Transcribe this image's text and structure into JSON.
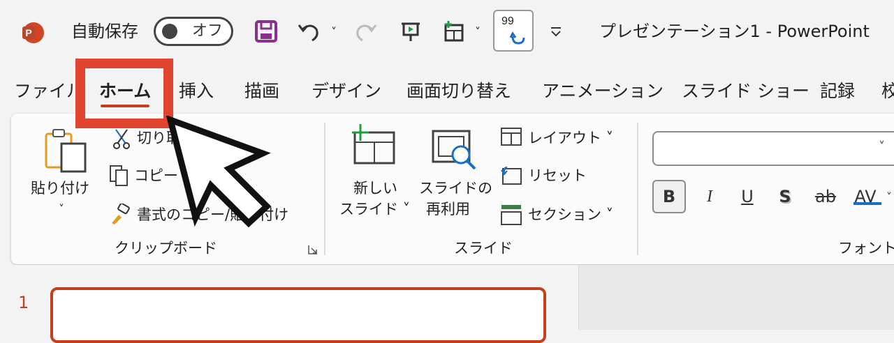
{
  "titlebar": {
    "autosave_label": "自動保存",
    "autosave_state": "オフ",
    "document_title": "プレゼンテーション1  -  PowerPoint",
    "icons": [
      "powerpoint-logo-icon",
      "save-icon",
      "undo-icon",
      "redo-icon",
      "present-icon",
      "layout-icon",
      "zoom-icon",
      "customize-qat-icon"
    ],
    "zoom_icon_text": "99"
  },
  "tabs": [
    "ファイル",
    "ホーム",
    "挿入",
    "描画",
    "デザイン",
    "画面切り替え",
    "アニメーション",
    "スライド ショー",
    "記録",
    "校"
  ],
  "active_tab": "ホーム",
  "ribbon": {
    "clipboard": {
      "paste_label_line1": "貼り付け",
      "paste_label_line2": "˅",
      "cut_label": "切り取",
      "copy_label": "コピー",
      "format_painter_label": "書式のコピー/貼り付け",
      "group_label": "クリップボード"
    },
    "slides": {
      "new_slide_line1": "新しい",
      "new_slide_line2": "スライド ˅",
      "reuse_line1": "スライドの",
      "reuse_line2": "再利用",
      "layout_label": "レイアウト ˅",
      "reset_label": "リセット",
      "section_label": "セクション ˅",
      "group_label": "スライド"
    },
    "font": {
      "font_name_value": "",
      "bold": "B",
      "italic": "I",
      "underline": "U",
      "shadow": "S",
      "strikethrough": "ab",
      "spacing": "AV",
      "group_label": "フォント"
    }
  },
  "thumbnails": {
    "slide_number": "1"
  },
  "colors": {
    "accent": "#c43e1c",
    "highlight": "#e2452f",
    "save_icon": "#8b2f8f"
  }
}
